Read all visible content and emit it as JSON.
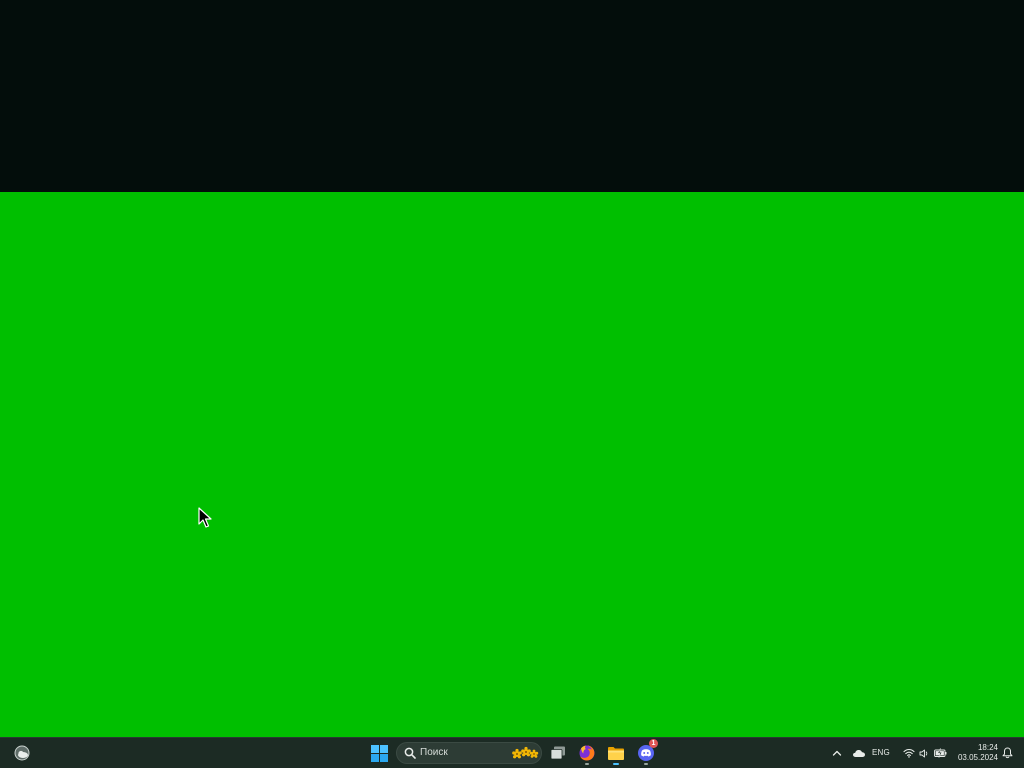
{
  "desktop": {
    "top_band_color": "#030d0b",
    "background_color": "#00bf00"
  },
  "taskbar": {
    "weather_widget": {
      "icon": "weather-cloudy-icon"
    },
    "start": {
      "icon": "windows-logo-icon",
      "accent": "#4cc2ff"
    },
    "search": {
      "placeholder": "Поиск",
      "icon": "search-icon",
      "decoration": "flowers-icon"
    },
    "pinned_apps": [
      {
        "name": "Task View",
        "icon": "task-view-icon"
      },
      {
        "name": "Firefox",
        "icon": "firefox-icon",
        "running": true
      },
      {
        "name": "File Explorer",
        "icon": "folder-icon",
        "running": true,
        "active": true
      },
      {
        "name": "Discord",
        "icon": "discord-icon",
        "running": true,
        "badge": "1"
      }
    ]
  },
  "tray": {
    "chevron_icon": "chevron-up-icon",
    "cloud_icon": "onedrive-icon",
    "language": "ENG",
    "wifi_icon": "wifi-icon",
    "volume_icon": "volume-icon",
    "battery_icon": "battery-charging-icon",
    "clock": {
      "time": "18:24",
      "date": "03.05.2024"
    },
    "notification_icon": "bell-icon"
  }
}
